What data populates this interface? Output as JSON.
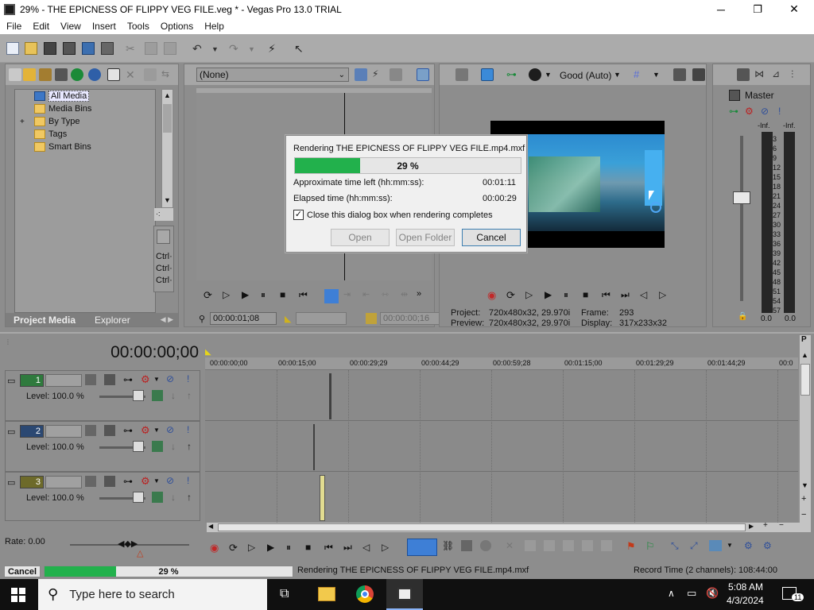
{
  "window": {
    "title": "29% - THE EPICNESS OF FLIPPY VEG FILE.veg * - Vegas Pro 13.0 TRIAL",
    "minimize": "─",
    "maximize": "❐",
    "close": "✕"
  },
  "menu": [
    "File",
    "Edit",
    "View",
    "Insert",
    "Tools",
    "Options",
    "Help"
  ],
  "project_media": {
    "tree": [
      {
        "label": "All Media",
        "selected": true,
        "expander": ""
      },
      {
        "label": "Media Bins",
        "expander": ""
      },
      {
        "label": "By Type",
        "expander": "+"
      },
      {
        "label": "Tags",
        "expander": ""
      },
      {
        "label": "Smart Bins",
        "expander": ""
      }
    ],
    "side_labels": [
      "Ctrl·",
      "Ctrl·",
      "Ctrl·"
    ],
    "side_glyph": "·:",
    "tabs": {
      "active": "Project Media",
      "inactive": "Explorer"
    }
  },
  "trimmer": {
    "preset": "(None)",
    "timecode_in": "00:00:01;08",
    "timecode_out": "00:00:00;16"
  },
  "preview": {
    "quality": "Good (Auto)",
    "project_label": "Project:",
    "project_value": "720x480x32, 29.970i",
    "preview_label": "Preview:",
    "preview_value": "720x480x32, 29.970i",
    "frame_label": "Frame:",
    "frame_value": "293",
    "display_label": "Display:",
    "display_value": "317x233x32"
  },
  "mixer": {
    "title": "Master",
    "inf_left": "-Inf.",
    "inf_right": "-Inf.",
    "scale": [
      "3",
      "6",
      "9",
      "12",
      "15",
      "18",
      "21",
      "24",
      "27",
      "30",
      "33",
      "36",
      "39",
      "42",
      "45",
      "48",
      "51",
      "54",
      "57"
    ],
    "value_left": "0.0",
    "value_right": "0.0"
  },
  "timeline": {
    "timecode": "00:00:00;00",
    "ruler": [
      "00:00:00;00",
      "00:00:15;00",
      "00:00:29;29",
      "00:00:44;29",
      "00:00:59;28",
      "00:01:15;00",
      "00:01:29;29",
      "00:01:44;29",
      "00:0"
    ],
    "tracks": [
      {
        "number": "1",
        "level": "Level: 100.0 %"
      },
      {
        "number": "2",
        "level": "Level: 100.0 %"
      },
      {
        "number": "3",
        "level": "Level: 100.0 %"
      }
    ],
    "rate": "Rate: 0.00"
  },
  "render_dialog": {
    "title": "Rendering THE EPICNESS OF FLIPPY VEG FILE.mp4.mxf",
    "progress": 29,
    "progress_label": "29 %",
    "time_left_label": "Approximate time left (hh:mm:ss):",
    "time_left_value": "00:01:11",
    "elapsed_label": "Elapsed time (hh:mm:ss):",
    "elapsed_value": "00:00:29",
    "close_checkbox_label": "Close this dialog box when rendering completes",
    "close_checkbox_checked": true,
    "open_button": "Open",
    "open_folder_button": "Open Folder",
    "cancel_button": "Cancel"
  },
  "status": {
    "cancel": "Cancel",
    "progress": 29,
    "progress_label": "29 %",
    "message": "Rendering THE EPICNESS OF FLIPPY VEG FILE.mp4.mxf",
    "record_time": "Record Time (2 channels): 108:44:00"
  },
  "taskbar": {
    "search_placeholder": "Type here to search",
    "time": "5:08 AM",
    "date": "4/3/2024",
    "notification_count": "11"
  },
  "colors": {
    "progress_green": "#22b14c",
    "accent_blue": "#1e6fd9"
  }
}
